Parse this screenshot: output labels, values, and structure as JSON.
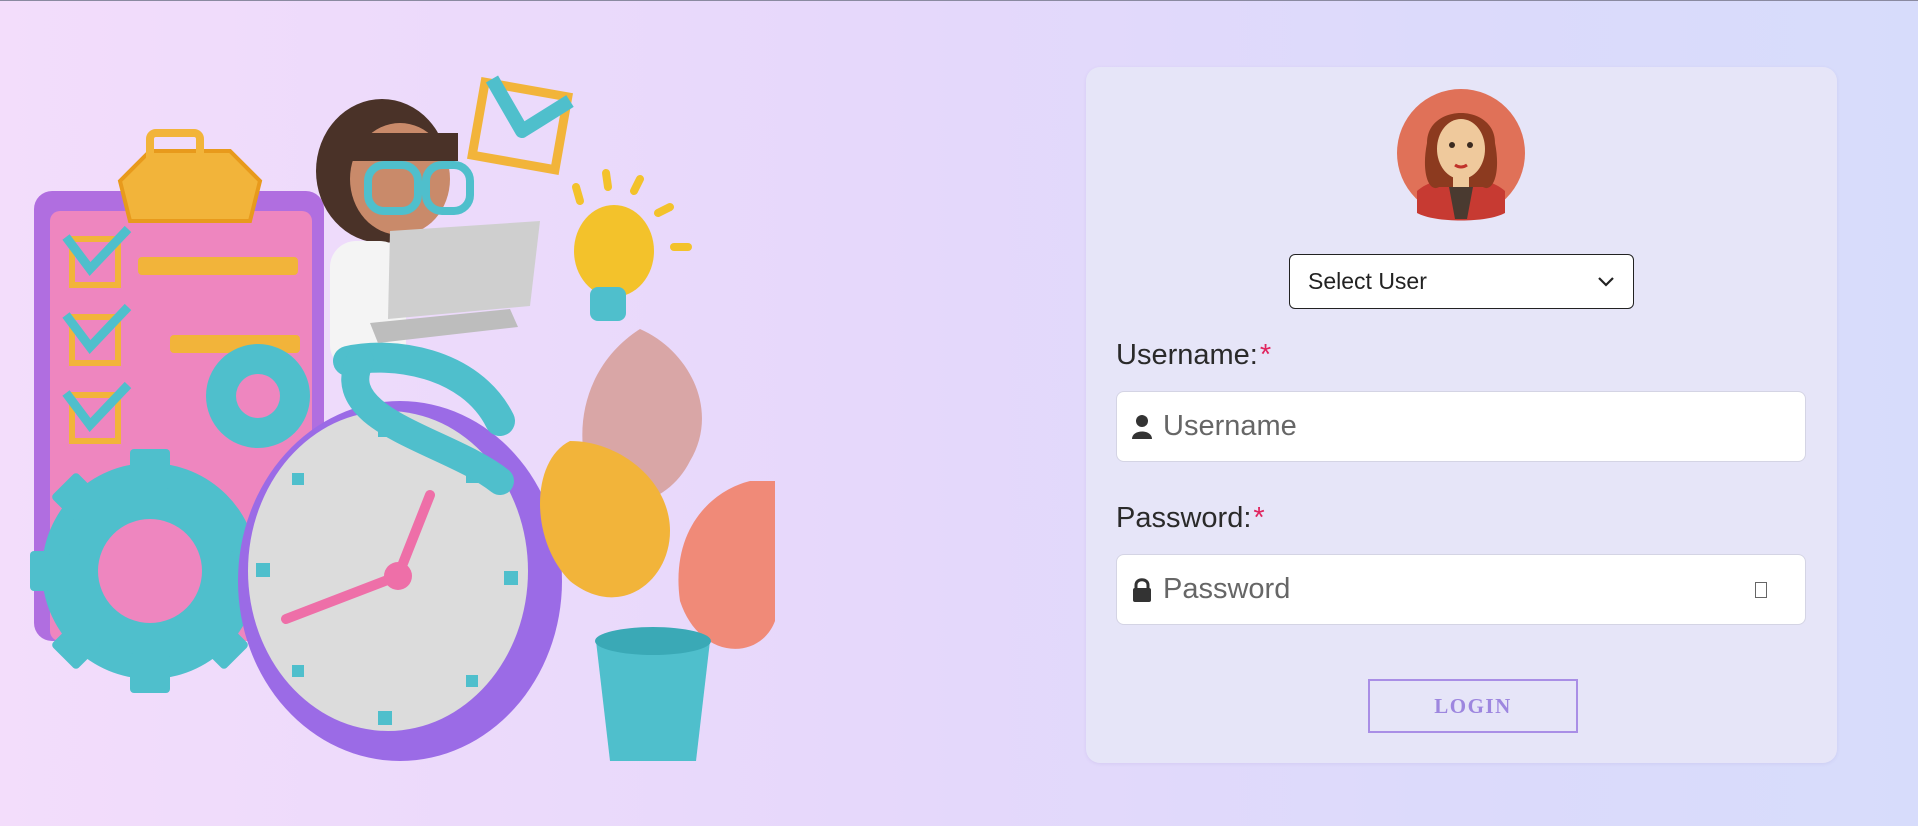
{
  "login_form": {
    "select_user": {
      "selected": "Select User"
    },
    "username": {
      "label": "Username:",
      "required_mark": "*",
      "placeholder": "Username",
      "value": ""
    },
    "password": {
      "label": "Password:",
      "required_mark": "*",
      "placeholder": "Password",
      "value": ""
    },
    "login_button": "LOGIN"
  },
  "icons": {
    "select_arrow": "chevron-down-icon",
    "username": "user-icon",
    "password": "lock-icon",
    "password_toggle": "eye-toggle-icon"
  },
  "colors": {
    "required": "#e0245e",
    "login_accent": "#a98ee6",
    "card_background": "#e6e5f8"
  }
}
